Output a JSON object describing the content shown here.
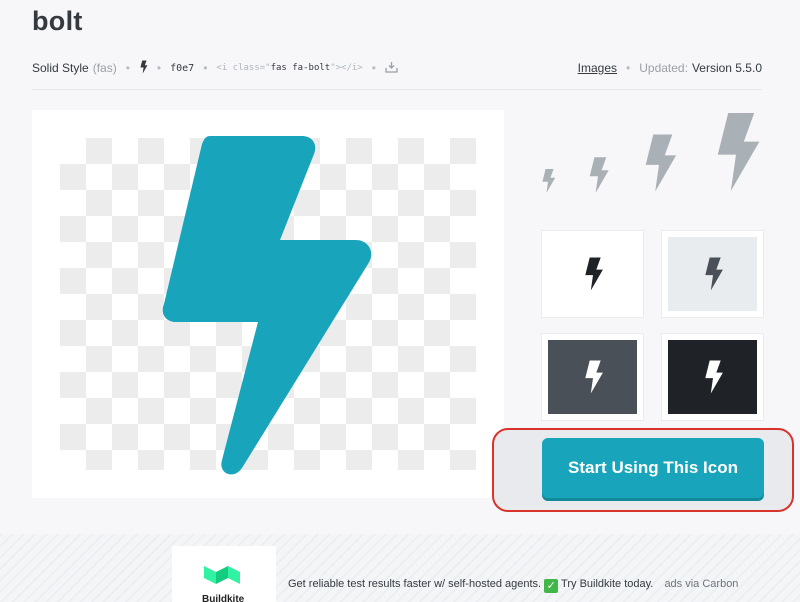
{
  "page": {
    "title": "bolt"
  },
  "meta": {
    "style_label": "Solid Style",
    "style_prefix": "(fas)",
    "unicode": "f0e7",
    "snippet_pre": "<i class=\"",
    "snippet_class": "fas fa-bolt",
    "snippet_post": "\"></i>",
    "images_link": "Images",
    "updated_label": "Updated:",
    "version": "Version 5.5.0",
    "icons": [
      "bolt-icon",
      "download-icon"
    ]
  },
  "colors": {
    "brand_teal": "#18a5bb",
    "icon_gray": "#a9b0b6",
    "dark_tile": "#1f2328",
    "mid_tile": "#495057",
    "light_tile": "#e9ecef",
    "highlight_red": "#d9342b"
  },
  "cta": {
    "label": "Start Using This Icon"
  },
  "ad": {
    "brand": "Buildkite",
    "text": "Get reliable test results faster w/ self-hosted agents.",
    "check_glyph": "✓",
    "link_text": "Try Buildkite today.",
    "via": "ads via Carbon"
  }
}
